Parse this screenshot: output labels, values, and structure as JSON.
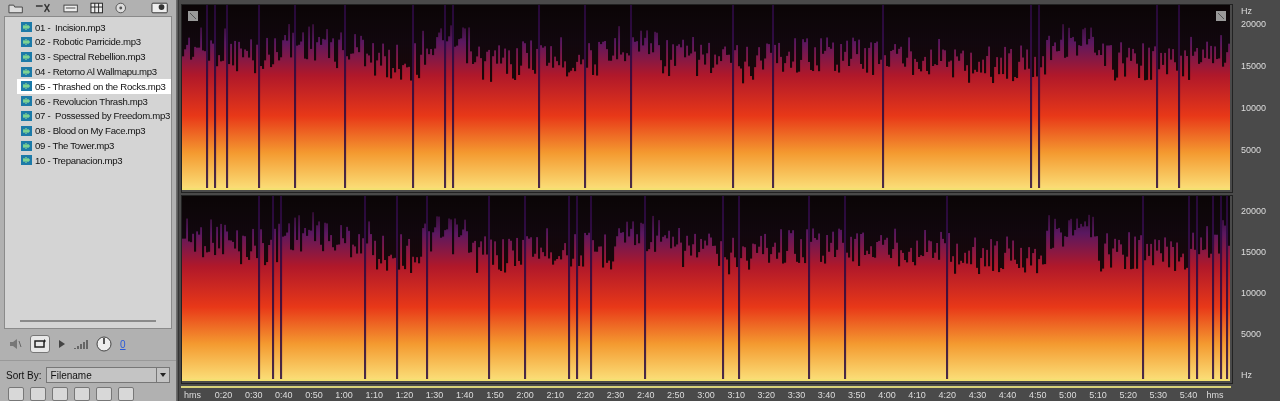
{
  "files": [
    {
      "name": "01 -  Incision.mp3",
      "selected": false
    },
    {
      "name": "02 - Robotic Parricide.mp3",
      "selected": false
    },
    {
      "name": "03 - Spectral Rebellion.mp3",
      "selected": false
    },
    {
      "name": "04 - Retorno Al Wallmapu.mp3",
      "selected": false
    },
    {
      "name": "05 - Thrashed on the Rocks.mp3",
      "selected": true
    },
    {
      "name": "06 - Revolucion Thrash.mp3",
      "selected": false
    },
    {
      "name": "07 -  Possessed by Freedom.mp3",
      "selected": false
    },
    {
      "name": "08 - Blood on My Face.mp3",
      "selected": false
    },
    {
      "name": "09 - The Tower.mp3",
      "selected": false
    },
    {
      "name": "10 - Trepanacion.mp3",
      "selected": false
    }
  ],
  "playback": {
    "loop_on": true,
    "volume_value": "0"
  },
  "sort": {
    "label": "Sort By:",
    "value": "Filename"
  },
  "channels": [
    {
      "unit_label": "Hz",
      "kind": "top",
      "ticks": [
        "20000",
        "15000",
        "10000",
        "5000"
      ]
    },
    {
      "unit_label": "Hz",
      "kind": "bottom",
      "ticks": [
        "20000",
        "15000",
        "10000",
        "5000"
      ]
    }
  ],
  "time_axis": {
    "start_label": "hms",
    "end_label": "hms",
    "ticks": [
      "0:20",
      "0:30",
      "0:40",
      "0:50",
      "1:00",
      "1:10",
      "1:20",
      "1:30",
      "1:40",
      "1:50",
      "2:00",
      "2:10",
      "2:20",
      "2:30",
      "2:40",
      "2:50",
      "3:00",
      "3:10",
      "3:20",
      "3:30",
      "3:40",
      "3:50",
      "4:00",
      "4:10",
      "4:20",
      "4:30",
      "4:40",
      "4:50",
      "5:00",
      "5:10",
      "5:20",
      "5:30",
      "5:40"
    ]
  }
}
